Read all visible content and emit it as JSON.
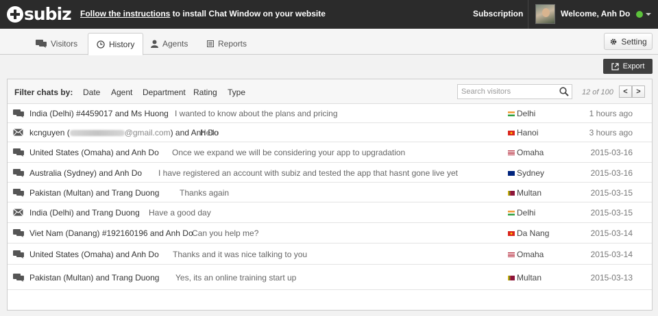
{
  "topbar": {
    "logo_text": "subiz",
    "install_link": "Follow the instructions",
    "install_rest": " to install Chat Window on your website",
    "subscription": "Subscription",
    "welcome": "Welcome, Anh Do",
    "status_color": "#5cc23b"
  },
  "tabs": [
    {
      "label": "Visitors",
      "icon": "chat-bubble-icon"
    },
    {
      "label": "History",
      "icon": "clock-icon",
      "active": true
    },
    {
      "label": "Agents",
      "icon": "user-icon"
    },
    {
      "label": "Reports",
      "icon": "report-icon"
    }
  ],
  "setting_label": "Setting",
  "export_label": "Export",
  "filter": {
    "label": "Filter chats by:",
    "options": [
      "Date",
      "Agent",
      "Department",
      "Rating",
      "Type"
    ],
    "search_placeholder": "Search visitors",
    "pager": "12 of 100",
    "prev": "<",
    "next": ">"
  },
  "chats": [
    {
      "type": "chat",
      "title": "India (Delhi) #4459017 and Ms Huong",
      "message": "I wanted to know about the plans and pricing",
      "location": "Delhi",
      "flag": "india",
      "time": "1 hours ago"
    },
    {
      "type": "mail",
      "title_pre": "kcnguyen (",
      "title_email": "@gmail.com",
      "title_post": ") and Anh Do",
      "message": "Hello",
      "location": "Hanoi",
      "flag": "vietnam",
      "time": "3 hours ago"
    },
    {
      "type": "chat",
      "title": "United States (Omaha) and Anh Do",
      "message": "Once we expand we will be considering your app to upgradation",
      "location": "Omaha",
      "flag": "usa",
      "time": "2015-03-16"
    },
    {
      "type": "chat",
      "title": "Australia (Sydney) and Anh Do",
      "message": "I have registered an account with subiz and tested the app that hasnt gone live yet",
      "location": "Sydney",
      "flag": "australia",
      "time": "2015-03-16"
    },
    {
      "type": "chat",
      "title": "Pakistan (Multan) and Trang Duong",
      "message": "Thanks again",
      "location": "Multan",
      "flag": "srilanka",
      "time": "2015-03-15"
    },
    {
      "type": "mail",
      "title": "India (Delhi) and Trang Duong",
      "message": "Have a good day",
      "location": "Delhi",
      "flag": "india",
      "time": "2015-03-15"
    },
    {
      "type": "chat",
      "title": "Viet Nam (Danang) #192160196 and Anh Do",
      "message": "Can you help me?",
      "location": "Da Nang",
      "flag": "vietnam",
      "time": "2015-03-14"
    },
    {
      "type": "chat",
      "title": "United States (Omaha) and Anh Do",
      "message": "Thanks and it was nice talking to you",
      "location": "Omaha",
      "flag": "usa",
      "time": "2015-03-14"
    },
    {
      "type": "chat",
      "title": "Pakistan (Multan) and Trang Duong",
      "message": "Yes, its an online training start up",
      "location": "Multan",
      "flag": "srilanka",
      "time": "2015-03-13"
    }
  ]
}
